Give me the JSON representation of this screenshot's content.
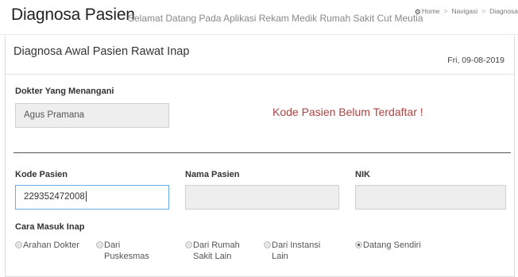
{
  "header": {
    "title": "Diagnosa Pasien",
    "subtitle": "Selamat Datang Pada Aplikasi Rekam Medik Rumah Sakit Cut Meutia"
  },
  "breadcrumb": {
    "home_icon": "dashboard-icon",
    "items": [
      "Home",
      "Navigasi",
      "Diagnosa"
    ]
  },
  "panel": {
    "title": "Diagnosa Awal Pasien Rawat Inap",
    "date": "Fri, 09-08-2019"
  },
  "doctor": {
    "label": "Dokter Yang Menangani",
    "value": "Agus Pramana"
  },
  "warning": "Kode Pasien Belum Terdaftar !",
  "form": {
    "kode_label": "Kode Pasien",
    "kode_value": "229352472008",
    "nama_label": "Nama Pasien",
    "nama_value": "",
    "nik_label": "NIK",
    "nik_value": ""
  },
  "cara_masuk": {
    "label": "Cara Masuk Inap",
    "options": [
      {
        "line1": "Arahan Dokter",
        "line2": "",
        "checked": false
      },
      {
        "line1": "Dari",
        "line2": "Puskesmas",
        "checked": false
      },
      {
        "line1": "Dari Rumah",
        "line2": "Sakit Lain",
        "checked": false
      },
      {
        "line1": "Dari Instansi",
        "line2": "Lain",
        "checked": false
      },
      {
        "line1": "Datang Sendiri",
        "line2": "",
        "checked": true
      }
    ]
  },
  "colors": {
    "warning": "#a94442",
    "focus_border": "#66afe9",
    "readonly_bg": "#eeeeee"
  }
}
